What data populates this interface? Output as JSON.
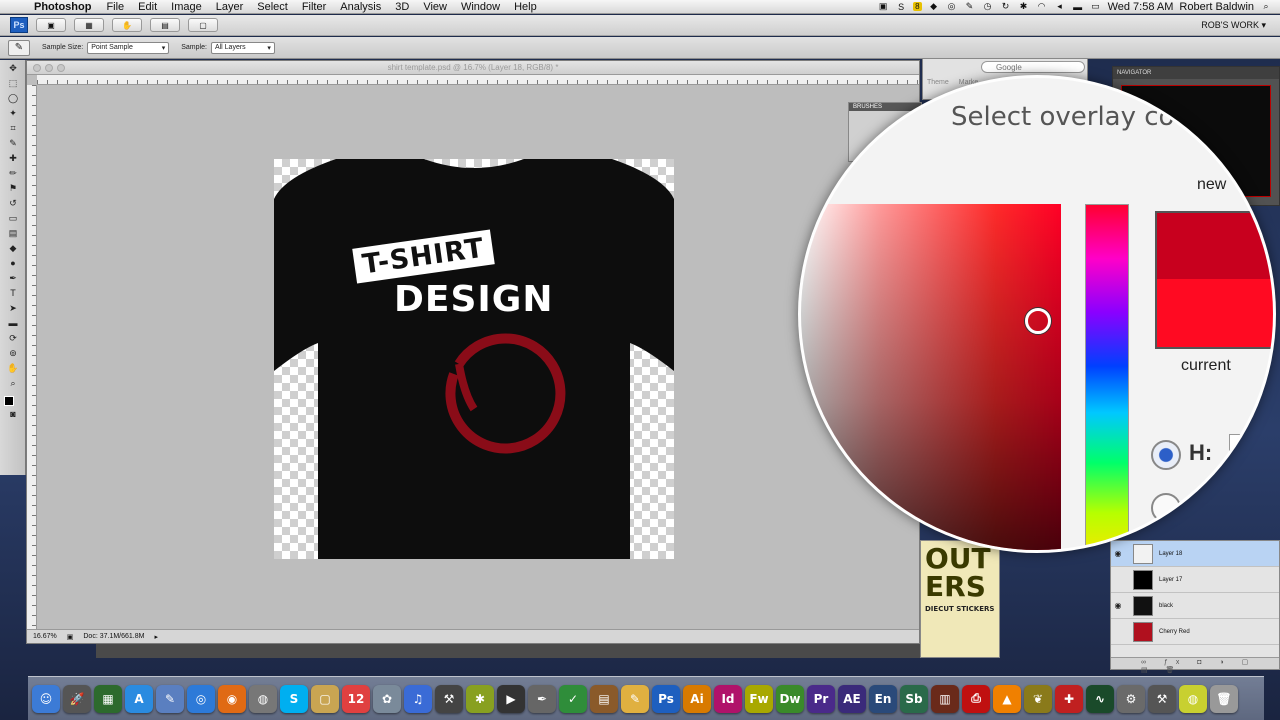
{
  "menubar": {
    "app": "Photoshop",
    "items": [
      "File",
      "Edit",
      "Image",
      "Layer",
      "Select",
      "Filter",
      "Analysis",
      "3D",
      "View",
      "Window",
      "Help"
    ],
    "clock": "Wed 7:58 AM",
    "user": "Robert Baldwin",
    "badge": "8"
  },
  "appbar": {
    "logo": "Ps",
    "workspace": "ROB'S WORK ▾"
  },
  "options": {
    "sample_size_label": "Sample Size:",
    "sample_size_value": "Point Sample",
    "sample_label": "Sample:",
    "sample_value": "All Layers"
  },
  "document": {
    "title": "shirt template.psd @ 16.7% (Layer 18, RGB/8) *",
    "zoom": "16.67%",
    "doc_size": "Doc: 37.1M/661.8M",
    "design_line1": "T-SHIRT",
    "design_line2": "DESIGN"
  },
  "minibridge": {
    "search_placeholder": "Google",
    "tabs": [
      "Theme",
      "Marke"
    ]
  },
  "brushes": {
    "title": "BRUSHES"
  },
  "navigator": {
    "title": "NAVIGATOR"
  },
  "magnifier": {
    "title": "Select overlay co",
    "new_label": "new",
    "current_label": "current",
    "h_label": "H:",
    "colors": {
      "new": "#c8001e",
      "current": "#ff0a22"
    }
  },
  "layers": {
    "items": [
      {
        "name": "Layer 18",
        "active": true,
        "thumb": "#f2f2f2"
      },
      {
        "name": "Layer 17",
        "active": false,
        "thumb": "#000000"
      },
      {
        "name": "black",
        "active": false,
        "thumb": "#111111"
      },
      {
        "name": "Cherry Red",
        "active": false,
        "thumb": "#b0101e"
      }
    ]
  },
  "ad": {
    "big": "OUT\nERS",
    "small": "DIECUT STICKERS"
  },
  "dock": {
    "icons": [
      {
        "name": "finder",
        "label": "☺",
        "color": "#3c7bd6"
      },
      {
        "name": "launchpad",
        "label": "🚀",
        "color": "#555"
      },
      {
        "name": "mission-control",
        "label": "▦",
        "color": "#2d6a2d"
      },
      {
        "name": "app-store",
        "label": "A",
        "color": "#2a8be0"
      },
      {
        "name": "preview",
        "label": "✎",
        "color": "#5a7fc0"
      },
      {
        "name": "safari",
        "label": "◎",
        "color": "#2d7ad8"
      },
      {
        "name": "firefox",
        "label": "◉",
        "color": "#e06a14"
      },
      {
        "name": "disk-utility",
        "label": "◍",
        "color": "#777"
      },
      {
        "name": "skype",
        "label": "S",
        "color": "#00aff0"
      },
      {
        "name": "folder",
        "label": "▢",
        "color": "#c9a552"
      },
      {
        "name": "calendar",
        "label": "12",
        "color": "#e04040"
      },
      {
        "name": "photos",
        "label": "✿",
        "color": "#7a8a9a"
      },
      {
        "name": "itunes",
        "label": "♫",
        "color": "#3a6bd6"
      },
      {
        "name": "xcode",
        "label": "⚒",
        "color": "#444"
      },
      {
        "name": "coda",
        "label": "✱",
        "color": "#88a020"
      },
      {
        "name": "imovie",
        "label": "▶",
        "color": "#333"
      },
      {
        "name": "pen-tool",
        "label": "✒",
        "color": "#666"
      },
      {
        "name": "textwrangler",
        "label": "✓",
        "color": "#2f8d3a"
      },
      {
        "name": "archive",
        "label": "▤",
        "color": "#8a5a2a"
      },
      {
        "name": "paint",
        "label": "✎",
        "color": "#e0b040"
      },
      {
        "name": "photoshop",
        "label": "Ps",
        "color": "#1e5fbf"
      },
      {
        "name": "illustrator",
        "label": "Ai",
        "color": "#d87a00"
      },
      {
        "name": "indesign",
        "label": "Id",
        "color": "#b0126a"
      },
      {
        "name": "fireworks",
        "label": "Fw",
        "color": "#a8a800"
      },
      {
        "name": "dreamweaver",
        "label": "Dw",
        "color": "#3a8a2a"
      },
      {
        "name": "premiere",
        "label": "Pr",
        "color": "#4a2a8a"
      },
      {
        "name": "after-effects",
        "label": "AE",
        "color": "#3a2a7a"
      },
      {
        "name": "encore",
        "label": "En",
        "color": "#2a4a7a"
      },
      {
        "name": "soundbooth",
        "label": "Sb",
        "color": "#2a6a4a"
      },
      {
        "name": "bridge",
        "label": "▥",
        "color": "#6a2a1a"
      },
      {
        "name": "acrobat",
        "label": "⎙",
        "color": "#c01010"
      },
      {
        "name": "vlc",
        "label": "▲",
        "color": "#f08000"
      },
      {
        "name": "pineapple",
        "label": "❦",
        "color": "#8a7a1a"
      },
      {
        "name": "flashcards",
        "label": "✚",
        "color": "#c02020"
      },
      {
        "name": "activity-monitor",
        "label": "∿",
        "color": "#1a4a2a"
      },
      {
        "name": "system-preferences",
        "label": "⚙",
        "color": "#6a6a6a"
      },
      {
        "name": "utilities",
        "label": "⚒",
        "color": "#555"
      },
      {
        "name": "tennis-ball",
        "label": "◍",
        "color": "#c8d030"
      },
      {
        "name": "trash",
        "label": "🗑",
        "color": "#999"
      }
    ]
  }
}
